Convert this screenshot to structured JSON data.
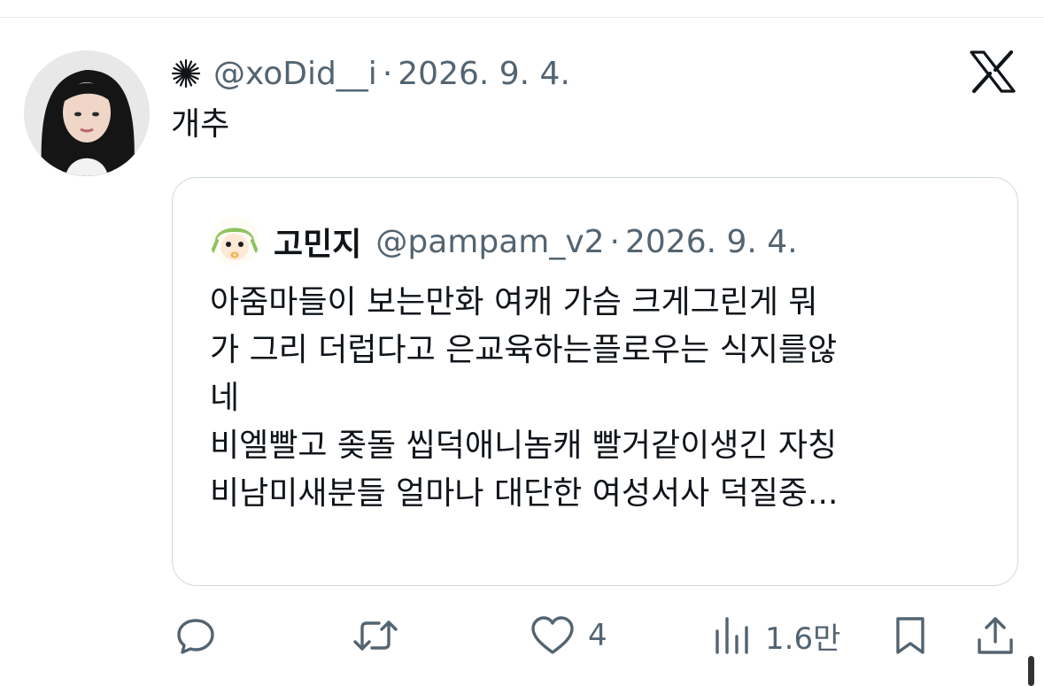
{
  "post": {
    "verified_badge_icon": "sparkle-icon",
    "handle": "@xoDid__i",
    "separator": "·",
    "date": "2026. 9. 4.",
    "text": "개추"
  },
  "quote": {
    "name": "고민지",
    "handle": "@pampam_v2",
    "separator": "·",
    "date": "2026. 9. 4.",
    "lines": [
      "아줌마들이 보는만화 여캐 가슴 크게그린게 뭐",
      "가 그리 더럽다고 은교육하는플로우는 식지를않",
      "네",
      "비엘빨고 좆돌 씹덕애니놈캐 빨거같이생긴 자칭",
      "비남미새분들 얼마나 대단한 여성서사 덕질중..."
    ]
  },
  "actions": {
    "reply_icon": "comment-icon",
    "repost_icon": "repost-icon",
    "like_icon": "heart-icon",
    "like_count": "4",
    "views_icon": "bar-chart-icon",
    "views_count": "1.6만",
    "bookmark_icon": "bookmark-icon",
    "share_icon": "share-icon"
  },
  "brand": {
    "logo": "x-logo-icon"
  },
  "colors": {
    "text": "#0f1419",
    "secondary": "#536471",
    "border": "#cfd9de"
  }
}
